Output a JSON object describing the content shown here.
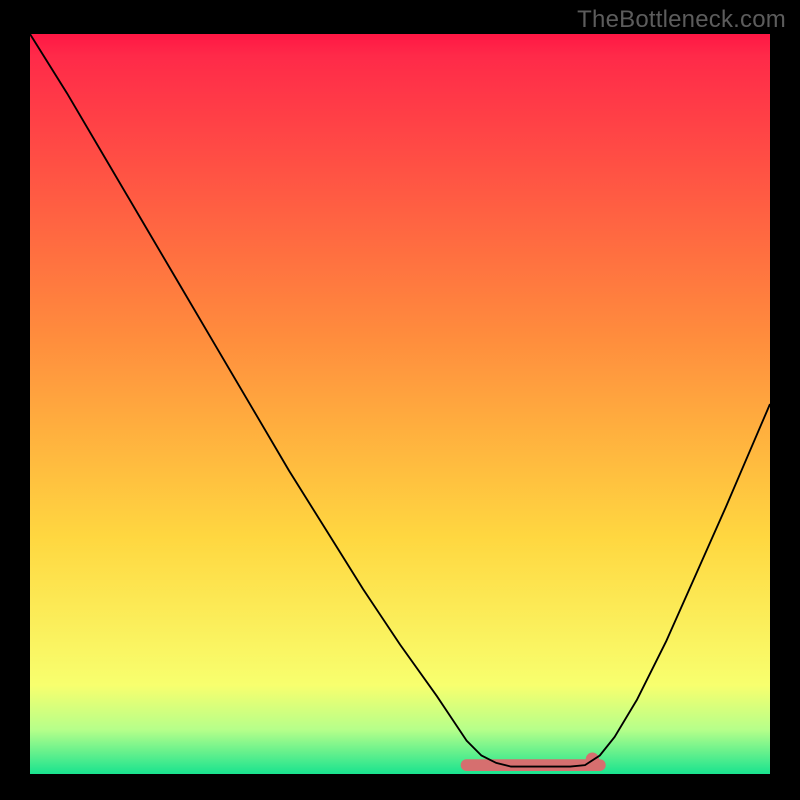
{
  "watermark": "TheBottleneck.com",
  "chart_data": {
    "type": "line",
    "title": "",
    "xlabel": "",
    "ylabel": "",
    "xlim": [
      0,
      100
    ],
    "ylim": [
      0,
      100
    ],
    "grid": false,
    "legend": false,
    "series": [
      {
        "name": "curve",
        "stroke": "#000000",
        "fill": "none",
        "points": [
          {
            "x": 0.0,
            "y": 100.0
          },
          {
            "x": 5.0,
            "y": 92.0
          },
          {
            "x": 10.0,
            "y": 83.5
          },
          {
            "x": 15.0,
            "y": 75.0
          },
          {
            "x": 20.0,
            "y": 66.5
          },
          {
            "x": 25.0,
            "y": 58.0
          },
          {
            "x": 30.0,
            "y": 49.5
          },
          {
            "x": 35.0,
            "y": 41.0
          },
          {
            "x": 40.0,
            "y": 33.0
          },
          {
            "x": 45.0,
            "y": 25.0
          },
          {
            "x": 50.0,
            "y": 17.5
          },
          {
            "x": 55.0,
            "y": 10.5
          },
          {
            "x": 57.0,
            "y": 7.5
          },
          {
            "x": 59.0,
            "y": 4.5
          },
          {
            "x": 61.0,
            "y": 2.5
          },
          {
            "x": 63.0,
            "y": 1.5
          },
          {
            "x": 65.0,
            "y": 1.0
          },
          {
            "x": 67.0,
            "y": 1.0
          },
          {
            "x": 69.0,
            "y": 1.0
          },
          {
            "x": 71.0,
            "y": 1.0
          },
          {
            "x": 73.0,
            "y": 1.0
          },
          {
            "x": 75.0,
            "y": 1.2
          },
          {
            "x": 77.0,
            "y": 2.5
          },
          {
            "x": 79.0,
            "y": 5.0
          },
          {
            "x": 82.0,
            "y": 10.0
          },
          {
            "x": 86.0,
            "y": 18.0
          },
          {
            "x": 90.0,
            "y": 27.0
          },
          {
            "x": 94.0,
            "y": 36.0
          },
          {
            "x": 100.0,
            "y": 50.0
          }
        ]
      }
    ],
    "flat_region": {
      "x0": 59.0,
      "x1": 77.0,
      "y": 1.2,
      "color": "#D66F6F"
    },
    "dot": {
      "x": 76.0,
      "y": 2.0,
      "r": 0.9,
      "color": "#D66F6F"
    },
    "gradient_bands": [
      {
        "y0": 100,
        "y1": 97,
        "c0": "#FF1744",
        "c1": "#FF2A49"
      },
      {
        "y0": 97,
        "y1": 60,
        "c0": "#FF2A49",
        "c1": "#FF8A3D"
      },
      {
        "y0": 60,
        "y1": 32,
        "c0": "#FF8A3D",
        "c1": "#FFD740"
      },
      {
        "y0": 32,
        "y1": 12,
        "c0": "#FFD740",
        "c1": "#F8FF6E"
      },
      {
        "y0": 12,
        "y1": 6,
        "c0": "#F8FF6E",
        "c1": "#B6FF8A"
      },
      {
        "y0": 6,
        "y1": 0,
        "c0": "#B6FF8A",
        "c1": "#19E38F"
      }
    ]
  }
}
